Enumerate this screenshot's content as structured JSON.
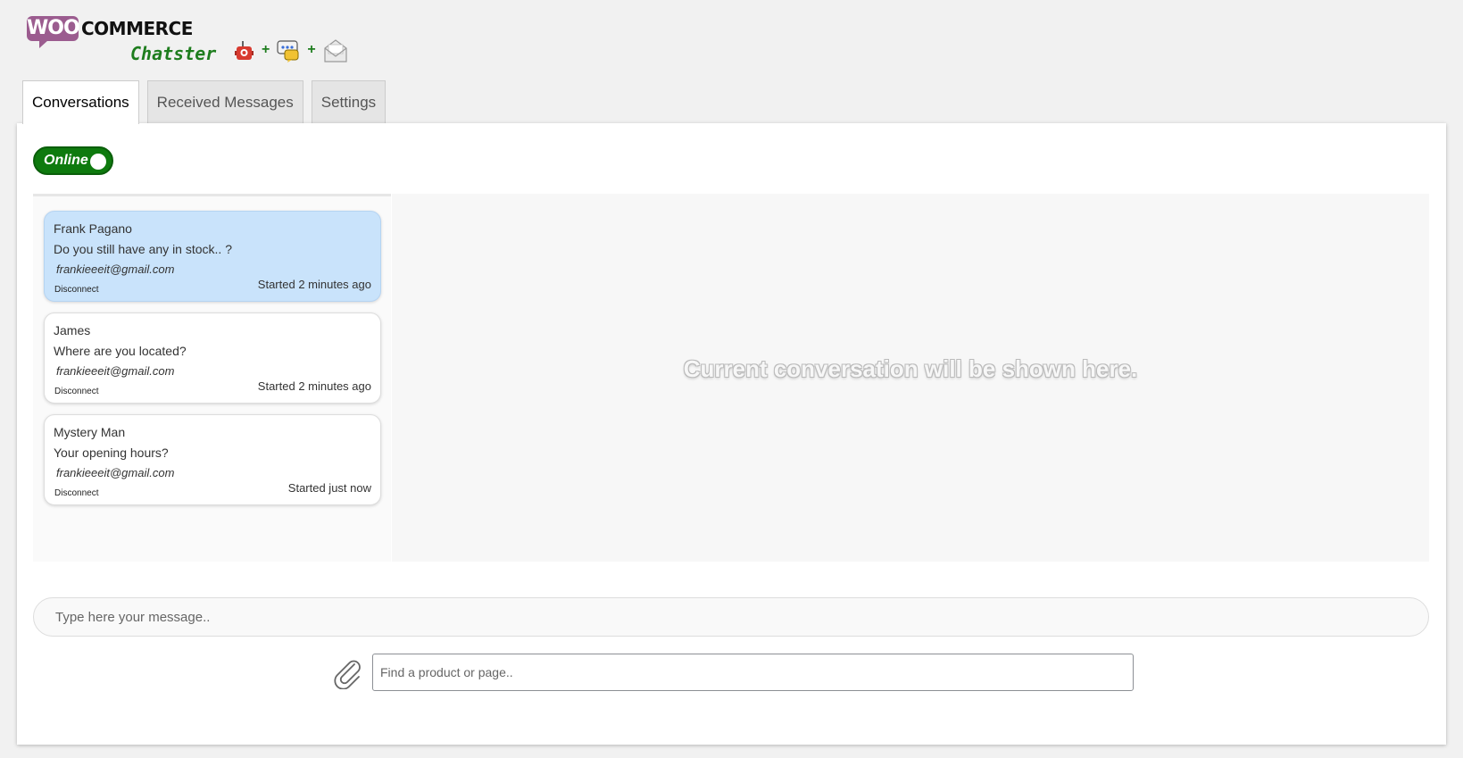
{
  "logo": {
    "woo": "WOO",
    "commerce": "COMMERCE",
    "chatster": "Chatster",
    "plus": "+",
    "icons": [
      "robot-icon",
      "chat-bubble-icon",
      "envelope-icon"
    ]
  },
  "tabs": [
    {
      "label": "Conversations",
      "active": true
    },
    {
      "label": "Received Messages",
      "active": false
    },
    {
      "label": "Settings",
      "active": false
    }
  ],
  "status_toggle": {
    "label": "Online",
    "on": true,
    "color": "#0e7a0e"
  },
  "conversations": [
    {
      "name": "Frank Pagano",
      "message": "Do you still have any in stock.. ?",
      "email": "frankieeeit@gmail.com",
      "started": "Started 2 minutes ago",
      "disconnect": "Disconnect",
      "selected": true
    },
    {
      "name": "James",
      "message": "Where are you located?",
      "email": "frankieeeit@gmail.com",
      "started": "Started 2 minutes ago",
      "disconnect": "Disconnect",
      "selected": false
    },
    {
      "name": "Mystery Man",
      "message": "Your opening hours?",
      "email": "frankieeeit@gmail.com",
      "started": "Started just now",
      "disconnect": "Disconnect",
      "selected": false
    }
  ],
  "conversation_placeholder": "Current conversation will be shown here.",
  "message_input": {
    "placeholder": "Type here your message..",
    "value": ""
  },
  "attach_icon": "paperclip-icon",
  "find_input": {
    "placeholder": "Find a product or page..",
    "value": ""
  },
  "colors": {
    "accent_green": "#1e7d1e",
    "woo_purple": "#9b5c8f",
    "selected_card": "#c9e3fb"
  }
}
